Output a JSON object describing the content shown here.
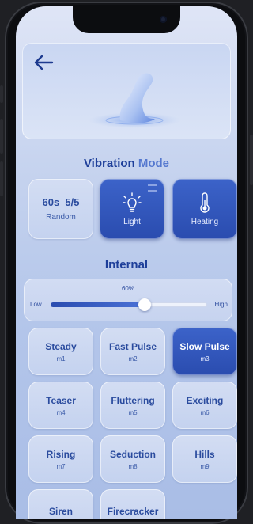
{
  "header": {
    "back_label": ""
  },
  "vibration": {
    "title_part1": "Vibration",
    "title_part2": "Mode",
    "random": {
      "top": "60s  5/5",
      "label": "Random"
    },
    "light": {
      "label": "Light",
      "icon": "light-bulb-icon"
    },
    "heating": {
      "label": "Heating",
      "icon": "thermometer-icon"
    }
  },
  "internal": {
    "title": "Internal",
    "slider": {
      "percent_text": "60%",
      "value": 0.6,
      "low": "Low",
      "high": "High"
    }
  },
  "modes": [
    {
      "name": "Steady",
      "code": "m1",
      "active": false
    },
    {
      "name": "Fast Pulse",
      "code": "m2",
      "active": false
    },
    {
      "name": "Slow Pulse",
      "code": "m3",
      "active": true
    },
    {
      "name": "Teaser",
      "code": "m4",
      "active": false
    },
    {
      "name": "Fluttering",
      "code": "m5",
      "active": false
    },
    {
      "name": "Exciting",
      "code": "m6",
      "active": false
    },
    {
      "name": "Rising",
      "code": "m7",
      "active": false
    },
    {
      "name": "Seduction",
      "code": "m8",
      "active": false
    },
    {
      "name": "Hills",
      "code": "m9",
      "active": false
    },
    {
      "name": "Siren",
      "code": "",
      "active": false
    },
    {
      "name": "Firecracker",
      "code": "",
      "active": false
    }
  ],
  "colors": {
    "accent": "#2a4caf",
    "title": "#1e3f9a",
    "title_accent": "#5578cf"
  }
}
